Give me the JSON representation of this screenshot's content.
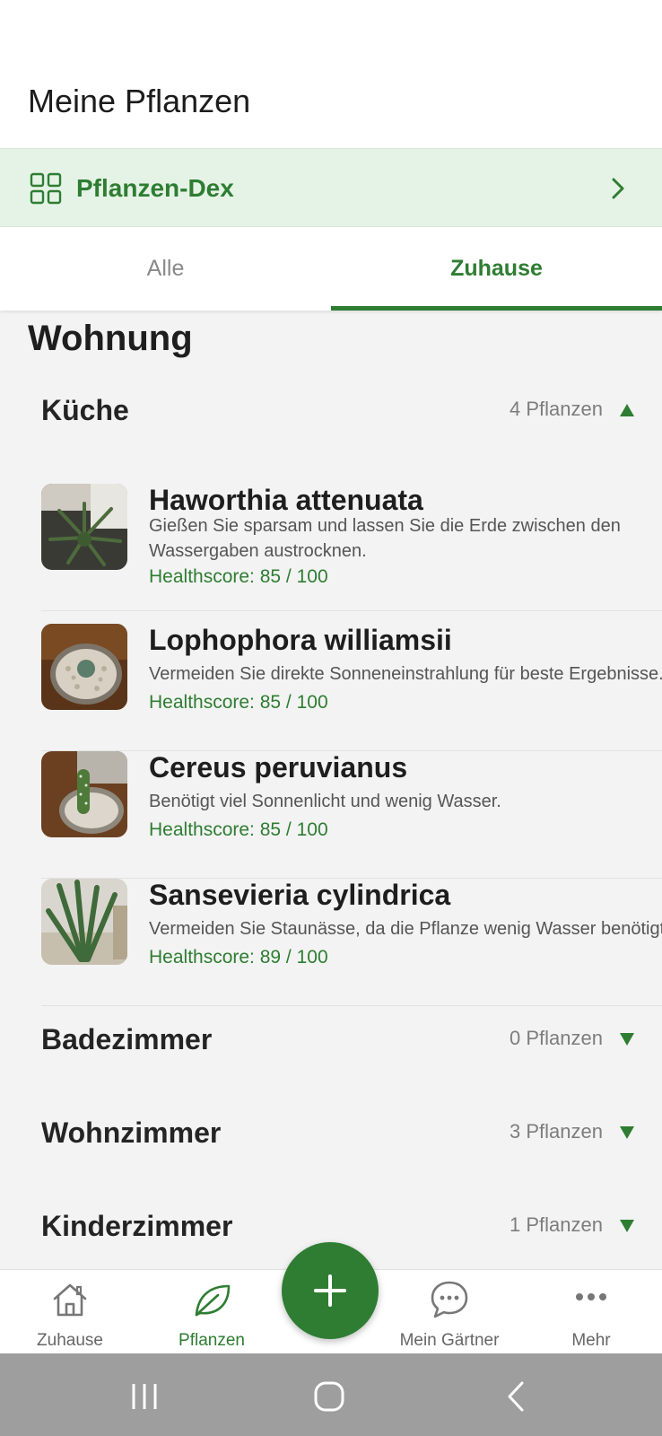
{
  "header": {
    "title": "Meine Pflanzen"
  },
  "dex_banner": {
    "icon": "grid-icon",
    "label": "Pflanzen-Dex",
    "chevron_icon": "chevron-right-icon"
  },
  "tabs": [
    {
      "label": "Alle",
      "active": false
    },
    {
      "label": "Zuhause",
      "active": true
    }
  ],
  "section": {
    "title": "Wohnung"
  },
  "rooms": [
    {
      "name": "Küche",
      "count": "4 Pflanzen",
      "expanded": true,
      "plants": [
        {
          "name": "Haworthia attenuata",
          "desc_line1": "Gießen Sie sparsam und lassen Sie die Erde zwischen den",
          "desc_line2": "Wassergaben austrocknen.",
          "health": "Healthscore: 85 / 100"
        },
        {
          "name": "Lophophora williamsii",
          "desc_line1": "Vermeiden Sie direkte Sonneneinstrahlung für beste Ergebnisse.",
          "health": "Healthscore: 85 / 100"
        },
        {
          "name": "Cereus peruvianus",
          "desc_line1": "Benötigt viel Sonnenlicht und wenig Wasser.",
          "health": "Healthscore: 85 / 100"
        },
        {
          "name": "Sansevieria cylindrica",
          "desc_line1": "Vermeiden Sie Staunässe, da die Pflanze wenig Wasser benötigt.",
          "health": "Healthscore: 89 / 100"
        }
      ]
    },
    {
      "name": "Badezimmer",
      "count": "0 Pflanzen",
      "expanded": false
    },
    {
      "name": "Wohnzimmer",
      "count": "3 Pflanzen",
      "expanded": false
    },
    {
      "name": "Kinderzimmer",
      "count": "1 Pflanzen",
      "expanded": false
    }
  ],
  "bottom_nav": [
    {
      "label": "Zuhause",
      "icon": "house-icon",
      "active": false
    },
    {
      "label": "Pflanzen",
      "icon": "leaf-icon",
      "active": true
    },
    {
      "label": "Mein Gärtner",
      "icon": "chat-bubble-icon",
      "active": false
    },
    {
      "label": "Mehr",
      "icon": "more-dots-icon",
      "active": false
    }
  ],
  "fab": {
    "icon": "plus-icon"
  },
  "colors": {
    "accent": "#2e7d32",
    "banner_bg": "#e5f3e6",
    "page_bg": "#f3f3f3"
  }
}
